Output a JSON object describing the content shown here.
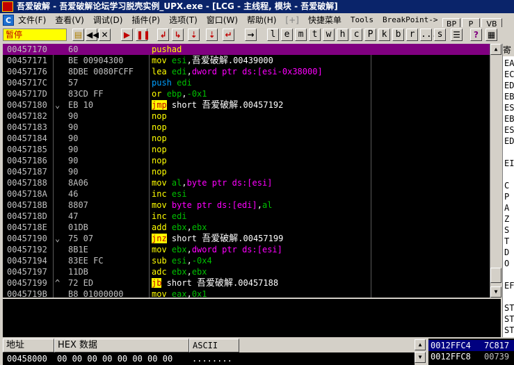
{
  "window": {
    "title": "吾爱破解 - 吾爱破解论坛学习脱壳实例_UPX.exe - [LCG - 主线程, 模块 - 吾爱破解]",
    "icon_text": "吾爱破解"
  },
  "menu": {
    "items": [
      "文件(F)",
      "查看(V)",
      "调试(D)",
      "插件(P)",
      "选项(T)",
      "窗口(W)",
      "帮助(H)",
      "[+]",
      "快捷菜单",
      "Tools",
      "BreakPoint->"
    ],
    "right_buttons": [
      "BP",
      "P",
      "VB"
    ]
  },
  "toolbar": {
    "status": "暂停",
    "letters": [
      "l",
      "e",
      "m",
      "t",
      "w",
      "h",
      "c",
      "P",
      "k",
      "b",
      "r",
      "...",
      "s"
    ]
  },
  "disasm": {
    "rows": [
      {
        "addr": "00457170",
        "mark": "",
        "hex": "60",
        "asm": [
          {
            "t": "pushad",
            "c": "y"
          }
        ],
        "sel": true
      },
      {
        "addr": "00457171",
        "mark": "",
        "hex": "BE 00904300",
        "asm": [
          {
            "t": "mov ",
            "c": "y"
          },
          {
            "t": "esi",
            "c": "g"
          },
          {
            "t": ",",
            "c": "w"
          },
          {
            "t": "吾爱破解",
            "c": "w",
            "cn": true
          },
          {
            "t": ".00439000",
            "c": "w"
          }
        ]
      },
      {
        "addr": "00457176",
        "mark": "",
        "hex": "8DBE 0080FCFF",
        "asm": [
          {
            "t": "lea ",
            "c": "y"
          },
          {
            "t": "edi",
            "c": "g"
          },
          {
            "t": ",",
            "c": "w"
          },
          {
            "t": "dword ptr ds:[esi-0x38000]",
            "c": "m"
          }
        ]
      },
      {
        "addr": "0045717C",
        "mark": "",
        "hex": "57",
        "asm": [
          {
            "t": "push ",
            "c": "c"
          },
          {
            "t": "edi",
            "c": "g"
          }
        ]
      },
      {
        "addr": "0045717D",
        "mark": "",
        "hex": "83CD FF",
        "asm": [
          {
            "t": "or ",
            "c": "y"
          },
          {
            "t": "ebp",
            "c": "g"
          },
          {
            "t": ",",
            "c": "w"
          },
          {
            "t": "-0x1",
            "c": "g"
          }
        ]
      },
      {
        "addr": "00457180",
        "mark": "⌄",
        "hex": "EB 10",
        "asm": [
          {
            "t": "jmp",
            "c": "jb"
          },
          {
            "t": " short ",
            "c": "w"
          },
          {
            "t": "吾爱破解",
            "c": "w",
            "cn": true
          },
          {
            "t": ".00457192",
            "c": "w"
          }
        ]
      },
      {
        "addr": "00457182",
        "mark": "",
        "hex": "90",
        "asm": [
          {
            "t": "nop",
            "c": "y"
          }
        ]
      },
      {
        "addr": "00457183",
        "mark": "",
        "hex": "90",
        "asm": [
          {
            "t": "nop",
            "c": "y"
          }
        ]
      },
      {
        "addr": "00457184",
        "mark": "",
        "hex": "90",
        "asm": [
          {
            "t": "nop",
            "c": "y"
          }
        ]
      },
      {
        "addr": "00457185",
        "mark": "",
        "hex": "90",
        "asm": [
          {
            "t": "nop",
            "c": "y"
          }
        ]
      },
      {
        "addr": "00457186",
        "mark": "",
        "hex": "90",
        "asm": [
          {
            "t": "nop",
            "c": "y"
          }
        ]
      },
      {
        "addr": "00457187",
        "mark": "",
        "hex": "90",
        "asm": [
          {
            "t": "nop",
            "c": "y"
          }
        ]
      },
      {
        "addr": "00457188",
        "mark": "",
        "hex": "8A06",
        "asm": [
          {
            "t": "mov ",
            "c": "y"
          },
          {
            "t": "al",
            "c": "g"
          },
          {
            "t": ",",
            "c": "w"
          },
          {
            "t": "byte ptr ds:[esi]",
            "c": "m"
          }
        ]
      },
      {
        "addr": "0045718A",
        "mark": "",
        "hex": "46",
        "asm": [
          {
            "t": "inc ",
            "c": "y"
          },
          {
            "t": "esi",
            "c": "g"
          }
        ]
      },
      {
        "addr": "0045718B",
        "mark": "",
        "hex": "8807",
        "asm": [
          {
            "t": "mov ",
            "c": "y"
          },
          {
            "t": "byte ptr ds:[edi]",
            "c": "m"
          },
          {
            "t": ",",
            "c": "w"
          },
          {
            "t": "al",
            "c": "g"
          }
        ]
      },
      {
        "addr": "0045718D",
        "mark": "",
        "hex": "47",
        "asm": [
          {
            "t": "inc ",
            "c": "y"
          },
          {
            "t": "edi",
            "c": "g"
          }
        ]
      },
      {
        "addr": "0045718E",
        "mark": "",
        "hex": "01DB",
        "asm": [
          {
            "t": "add ",
            "c": "y"
          },
          {
            "t": "ebx",
            "c": "g"
          },
          {
            "t": ",",
            "c": "w"
          },
          {
            "t": "ebx",
            "c": "g"
          }
        ]
      },
      {
        "addr": "00457190",
        "mark": "⌄",
        "hex": "75 07",
        "asm": [
          {
            "t": "jnz",
            "c": "jb"
          },
          {
            "t": " short ",
            "c": "w"
          },
          {
            "t": "吾爱破解",
            "c": "w",
            "cn": true
          },
          {
            "t": ".00457199",
            "c": "w"
          }
        ]
      },
      {
        "addr": "00457192",
        "mark": "",
        "hex": "8B1E",
        "asm": [
          {
            "t": "mov ",
            "c": "y"
          },
          {
            "t": "ebx",
            "c": "g"
          },
          {
            "t": ",",
            "c": "w"
          },
          {
            "t": "dword ptr ds:[esi]",
            "c": "m"
          }
        ]
      },
      {
        "addr": "00457194",
        "mark": "",
        "hex": "83EE FC",
        "asm": [
          {
            "t": "sub ",
            "c": "y"
          },
          {
            "t": "esi",
            "c": "g"
          },
          {
            "t": ",",
            "c": "w"
          },
          {
            "t": "-0x4",
            "c": "g"
          }
        ]
      },
      {
        "addr": "00457197",
        "mark": "",
        "hex": "11DB",
        "asm": [
          {
            "t": "adc ",
            "c": "y"
          },
          {
            "t": "ebx",
            "c": "g"
          },
          {
            "t": ",",
            "c": "w"
          },
          {
            "t": "ebx",
            "c": "g"
          }
        ]
      },
      {
        "addr": "00457199",
        "mark": "^",
        "hex": "72 ED",
        "asm": [
          {
            "t": "jb",
            "c": "jb"
          },
          {
            "t": " short ",
            "c": "w"
          },
          {
            "t": "吾爱破解",
            "c": "w",
            "cn": true
          },
          {
            "t": ".00457188",
            "c": "w"
          }
        ]
      },
      {
        "addr": "0045719B",
        "mark": "",
        "hex": "B8 01000000",
        "asm": [
          {
            "t": "mov ",
            "c": "y"
          },
          {
            "t": "eax",
            "c": "g"
          },
          {
            "t": ",",
            "c": "w"
          },
          {
            "t": "0x1",
            "c": "g"
          }
        ]
      }
    ]
  },
  "registers": {
    "header": "寄",
    "lines": [
      "EA",
      "EC",
      "ED",
      "EB",
      "ES",
      "EB",
      "ES",
      "ED",
      "",
      "EI",
      "",
      "C",
      "P",
      "A",
      "Z",
      "S",
      "T",
      "D",
      "O",
      "",
      "EF",
      "",
      "ST",
      "ST",
      "ST",
      "ST",
      "ST"
    ]
  },
  "dump": {
    "headers": [
      "地址",
      "HEX 数据",
      "ASCII"
    ],
    "row": {
      "addr": "00458000",
      "hex": "00 00 00 00 00 00 00 00",
      "ascii": "........"
    }
  },
  "stack": {
    "rows": [
      {
        "addr": "0012FFC4",
        "val": "7C817",
        "sel": true
      },
      {
        "addr": "0012FFC8",
        "val": "00739"
      }
    ]
  },
  "colors": {
    "accent_selected_row": "#800080",
    "title_bar": "#0a246a",
    "status_bg": "#ffff00"
  }
}
